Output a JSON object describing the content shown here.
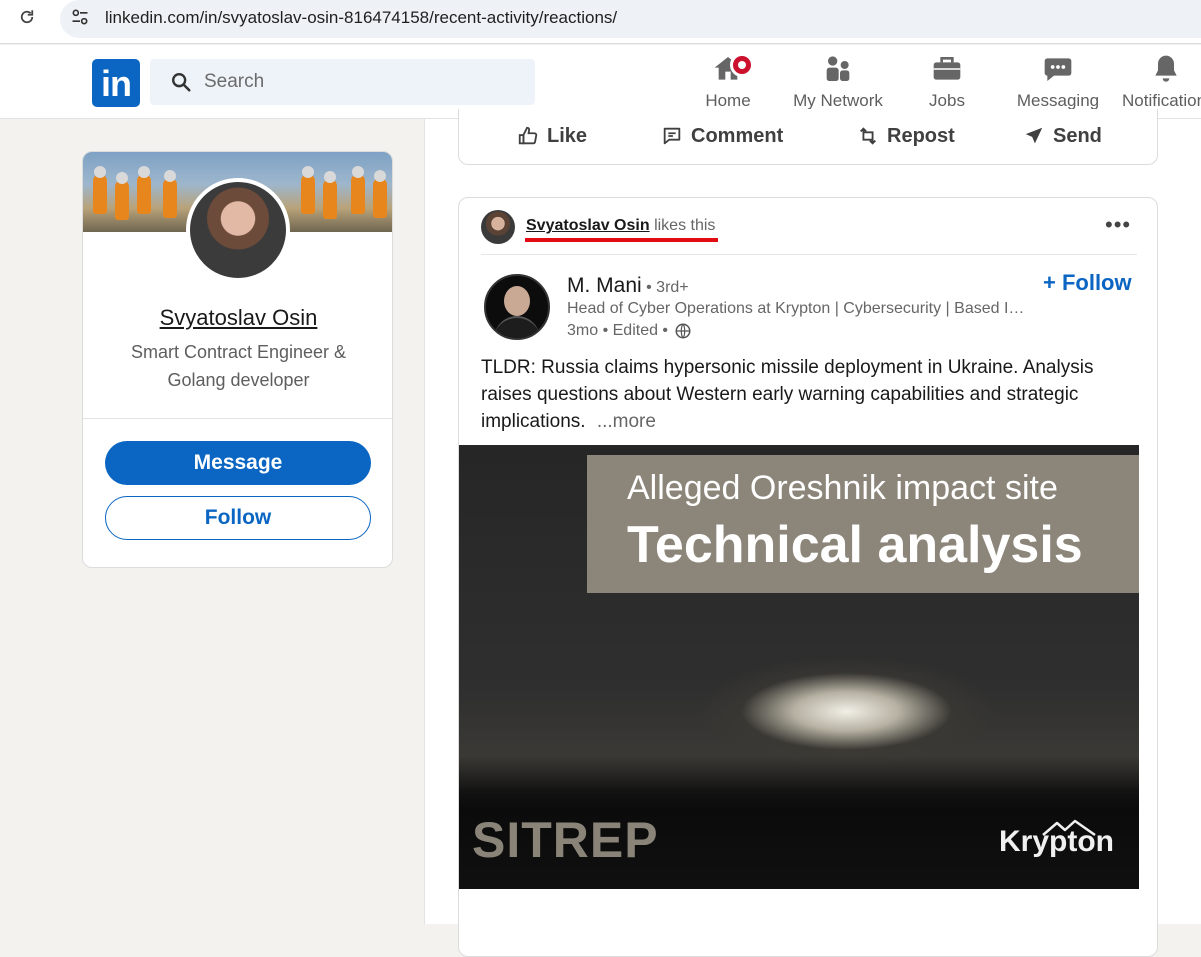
{
  "browser": {
    "url": "linkedin.com/in/svyatoslav-osin-816474158/recent-activity/reactions/",
    "icons": {
      "reload": "reload-icon",
      "site_info": "tune-icon"
    }
  },
  "header": {
    "logo_text": "in",
    "search_placeholder": "Search",
    "nav": [
      {
        "label": "Home",
        "icon": "home-icon",
        "has_badge": true
      },
      {
        "label": "My Network",
        "icon": "network-icon"
      },
      {
        "label": "Jobs",
        "icon": "briefcase-icon"
      },
      {
        "label": "Messaging",
        "icon": "messaging-icon"
      },
      {
        "label": "Notifications",
        "icon": "bell-icon"
      }
    ]
  },
  "profile": {
    "name": "Svyatoslav Osin",
    "headline": "Smart Contract Engineer & Golang developer",
    "message_label": "Message",
    "follow_label": "Follow"
  },
  "prev_post_actions": {
    "like": "Like",
    "comment": "Comment",
    "repost": "Repost",
    "send": "Send"
  },
  "post": {
    "reactor_name": "Svyatoslav Osin",
    "reactor_action": " likes this",
    "author_name": "M. Mani",
    "author_degree": " • 3rd+",
    "author_headline": "Head of Cyber Operations at Krypton | Cybersecurity | Based I…",
    "time": "3mo • Edited •",
    "follow_label": "+ Follow",
    "text": "TLDR: Russia claims hypersonic missile deployment in Ukraine. Analysis raises questions about Western early warning capabilities and strategic implications.",
    "see_more": "...more",
    "media": {
      "banner_line1": "Alleged Oreshnik impact site",
      "banner_line2": "Technical analysis",
      "watermark_left": "SITREP",
      "watermark_right": "Krypton"
    }
  },
  "colors": {
    "brand": "#0a66c2",
    "badge": "#cb112d",
    "annotation": "#e30b13",
    "banner": "#8c8579"
  }
}
